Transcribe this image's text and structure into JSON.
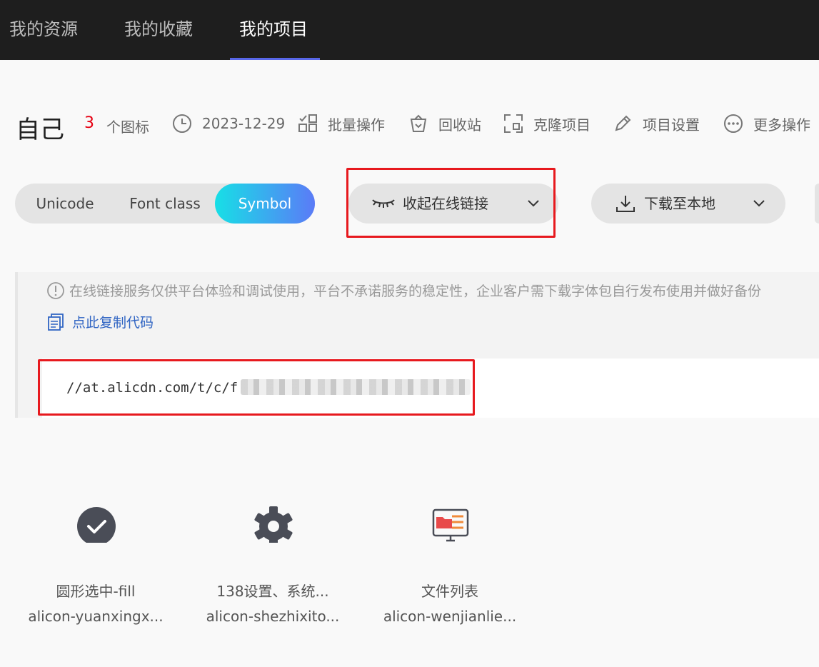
{
  "nav": {
    "tabs": [
      {
        "label": "我的资源"
      },
      {
        "label": "我的收藏"
      },
      {
        "label": "我的项目"
      }
    ],
    "active_index": 2,
    "accent_color": "#5867e8"
  },
  "project": {
    "name": "自己",
    "icon_count": "3",
    "icon_count_label": "个图标",
    "date": "2023-12-29",
    "actions": [
      {
        "label": "批量操作",
        "icon": "batch-icon"
      },
      {
        "label": "回收站",
        "icon": "recycle-bin-icon"
      },
      {
        "label": "克隆项目",
        "icon": "clone-icon"
      },
      {
        "label": "项目设置",
        "icon": "edit-settings-icon"
      },
      {
        "label": "更多操作",
        "icon": "more-icon"
      }
    ]
  },
  "modes": {
    "options": [
      "Unicode",
      "Font class",
      "Symbol"
    ],
    "selected": "Symbol"
  },
  "buttons": {
    "online_link": "收起在线链接",
    "download": "下载至本地"
  },
  "info": {
    "notice": "在线链接服务仅供平台体验和调试使用，平台不承诺服务的稳定性，企业客户需下载字体包自行发布使用并做好备份",
    "copy_code": "点此复制代码",
    "code_url": "//at.alicdn.com/t/c/f"
  },
  "icons": [
    {
      "name": "圆形选中-fill",
      "code": "alicon-yuanxingx...",
      "glyph": "check-circle-icon"
    },
    {
      "name": "138设置、系统...",
      "code": "alicon-shezhixito...",
      "glyph": "gear-icon"
    },
    {
      "name": "文件列表",
      "code": "alicon-wenjianlie...",
      "glyph": "file-list-icon"
    }
  ],
  "colors": {
    "count": "#e60012",
    "link": "#2f64c3",
    "highlight_box": "#e7191e",
    "symbol_gradient_start": "#17dfe6",
    "symbol_gradient_end": "#5b7bf7"
  }
}
